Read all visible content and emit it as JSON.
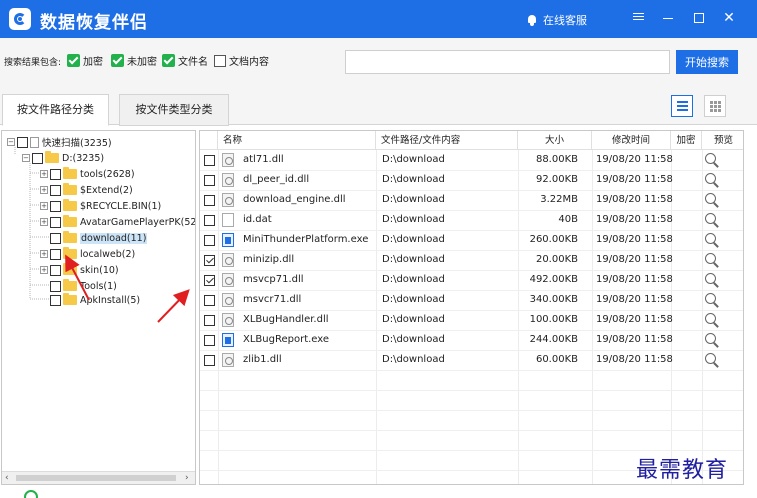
{
  "app": {
    "title": "数据恢复伴侣",
    "service_label": "在线客服"
  },
  "filter": {
    "label": "搜索结果包含:",
    "options": [
      {
        "label": "加密",
        "checked": true
      },
      {
        "label": "未加密",
        "checked": true
      },
      {
        "label": "文件名",
        "checked": true
      },
      {
        "label": "文档内容",
        "checked": false
      }
    ],
    "search_value": "",
    "search_button": "开始搜索"
  },
  "tabs": [
    {
      "label": "按文件路径分类",
      "active": true
    },
    {
      "label": "按文件类型分类",
      "active": false
    }
  ],
  "tree": {
    "root": "快速扫描(3235)",
    "drive": "D:(3235)",
    "folders": [
      {
        "label": "tools(2628)",
        "expandable": true
      },
      {
        "label": "$Extend(2)",
        "expandable": true
      },
      {
        "label": "$RECYCLE.BIN(1)",
        "expandable": true
      },
      {
        "label": "AvatarGamePlayerPK(524",
        "expandable": true
      },
      {
        "label": "download(11)",
        "expandable": false,
        "selected": true
      },
      {
        "label": "localweb(2)",
        "expandable": true
      },
      {
        "label": "skin(10)",
        "expandable": true
      },
      {
        "label": "Tools(1)",
        "expandable": false
      },
      {
        "label": "ApkInstall(5)",
        "expandable": false
      }
    ]
  },
  "table": {
    "columns": {
      "name": "名称",
      "path": "文件路径/文件内容",
      "size": "大小",
      "time": "修改时间",
      "encrypted": "加密",
      "preview": "预览"
    },
    "rows": [
      {
        "name": "atl71.dll",
        "path": "D:\\download",
        "size": "88.00KB",
        "time": "19/08/20 11:58",
        "type": "dll",
        "checked": false
      },
      {
        "name": "dl_peer_id.dll",
        "path": "D:\\download",
        "size": "92.00KB",
        "time": "19/08/20 11:58",
        "type": "dll",
        "checked": false
      },
      {
        "name": "download_engine.dll",
        "path": "D:\\download",
        "size": "3.22MB",
        "time": "19/08/20 11:58",
        "type": "dll",
        "checked": false
      },
      {
        "name": "id.dat",
        "path": "D:\\download",
        "size": "40B",
        "time": "19/08/20 11:58",
        "type": "dat",
        "checked": false
      },
      {
        "name": "MiniThunderPlatform.exe",
        "path": "D:\\download",
        "size": "260.00KB",
        "time": "19/08/20 11:58",
        "type": "exe",
        "checked": false
      },
      {
        "name": "minizip.dll",
        "path": "D:\\download",
        "size": "20.00KB",
        "time": "19/08/20 11:58",
        "type": "dll",
        "checked": true
      },
      {
        "name": "msvcp71.dll",
        "path": "D:\\download",
        "size": "492.00KB",
        "time": "19/08/20 11:58",
        "type": "dll",
        "checked": true
      },
      {
        "name": "msvcr71.dll",
        "path": "D:\\download",
        "size": "340.00KB",
        "time": "19/08/20 11:58",
        "type": "dll",
        "checked": false
      },
      {
        "name": "XLBugHandler.dll",
        "path": "D:\\download",
        "size": "100.00KB",
        "time": "19/08/20 11:58",
        "type": "dll",
        "checked": false
      },
      {
        "name": "XLBugReport.exe",
        "path": "D:\\download",
        "size": "244.00KB",
        "time": "19/08/20 11:58",
        "type": "exe",
        "checked": false
      },
      {
        "name": "zlib1.dll",
        "path": "D:\\download",
        "size": "60.00KB",
        "time": "19/08/20 11:58",
        "type": "dll",
        "checked": false
      }
    ]
  },
  "watermark": "最需教育",
  "colors": {
    "accent": "#1e6fe6",
    "check_green": "#22b14c",
    "annotation_red": "#e02020",
    "watermark": "#2020a0"
  },
  "icons": {
    "logo": "recovery-logo-icon",
    "service": "bell-icon",
    "preview": "magnifier-icon",
    "folder": "folder-icon"
  }
}
